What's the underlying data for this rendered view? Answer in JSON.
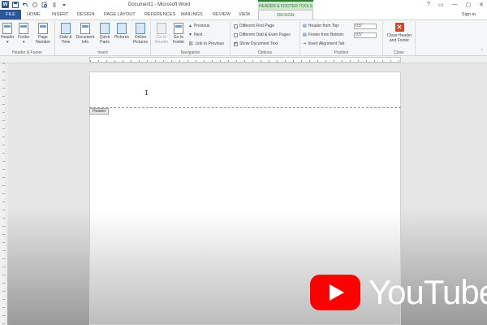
{
  "window": {
    "title": "Document1 - Microsoft Word",
    "contextual_tab": "HEADER & FOOTER TOOLS",
    "controls": [
      "?",
      "▭",
      "—",
      "▢",
      "✕"
    ]
  },
  "tabs": {
    "file": "FILE",
    "items": [
      "HOME",
      "INSERT",
      "DESIGN",
      "PAGE LAYOUT",
      "REFERENCES",
      "MAILINGS",
      "REVIEW",
      "VIEW"
    ],
    "active": "DESIGN",
    "sign_in": "Sign in"
  },
  "ribbon": {
    "header_footer": {
      "label": "Header & Footer",
      "header": "Header",
      "footer": "Footer",
      "page_number": "Page Number"
    },
    "insert": {
      "label": "Insert",
      "date_time": "Date & Time",
      "document_info": "Document Info",
      "quick_parts": "Quick Parts",
      "pictures": "Pictures",
      "online_pictures": "Online Pictures"
    },
    "navigation": {
      "label": "Navigation",
      "go_to_header": "Go to Header",
      "go_to_footer": "Go to Footer",
      "previous": "Previous",
      "next": "Next",
      "link_to_previous": "Link to Previous"
    },
    "options": {
      "label": "Options",
      "different_first_page": "Different First Page",
      "different_odd_even": "Different Odd & Even Pages",
      "show_document_text": "Show Document Text",
      "show_document_text_checked": true
    },
    "position": {
      "label": "Position",
      "header_from_top": "Header from Top:",
      "header_from_top_value": "0.5\"",
      "footer_from_bottom": "Footer from Bottom:",
      "footer_from_bottom_value": "0.5\"",
      "insert_alignment_tab": "Insert Alignment Tab"
    },
    "close": {
      "label": "Close",
      "close_header_footer": "Close Header and Footer"
    }
  },
  "document": {
    "header_tag": "Header"
  },
  "watermark": {
    "text": "YouTube"
  },
  "colors": {
    "word_blue": "#2b579a",
    "contextual_green": "#2e7d32",
    "youtube_red": "#ff0000"
  }
}
